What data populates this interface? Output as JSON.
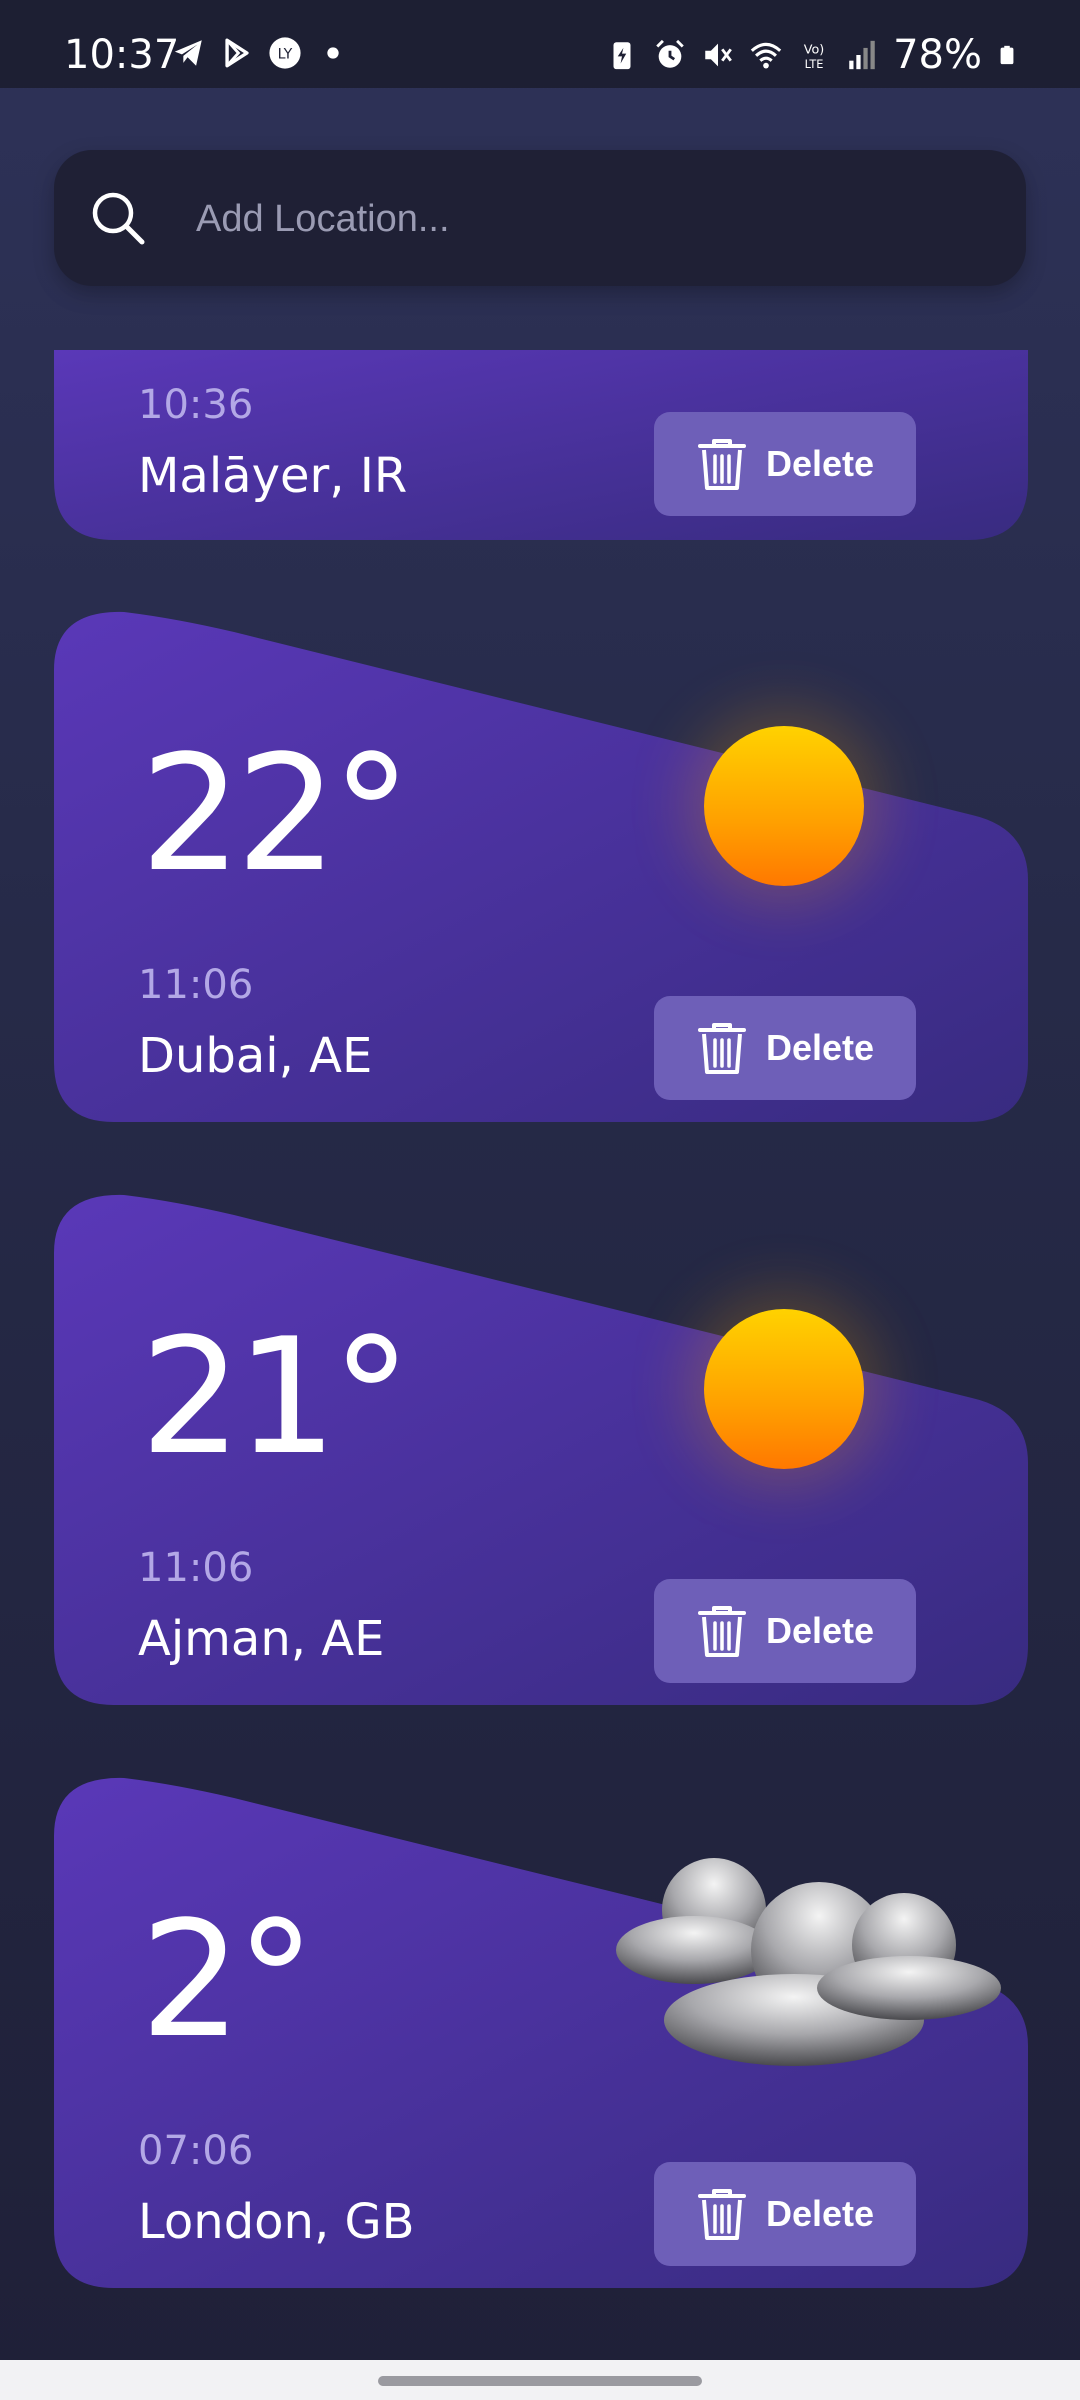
{
  "status_bar": {
    "time": "10:37",
    "battery_percent": "78%",
    "left_icons": [
      "telegram-icon",
      "play-store-icon",
      "ly-app-icon",
      "dot-icon"
    ],
    "right_icons": [
      "battery-saver-icon",
      "alarm-icon",
      "mute-icon",
      "wifi-icon",
      "volte-icon",
      "signal-icon",
      "battery-icon"
    ]
  },
  "search": {
    "placeholder": "Add Location...",
    "value": ""
  },
  "colors": {
    "card_top": "#5637b3",
    "card_bottom": "#3b2d86",
    "delete_button": "#6e5fb8",
    "sun": "#ffc000"
  },
  "cards": [
    {
      "time": "10:36",
      "city": "Malāyer, IR",
      "delete_label": "Delete"
    },
    {
      "temp": "22°",
      "time": "11:06",
      "city": "Dubai, AE",
      "icon": "sun-icon",
      "delete_label": "Delete"
    },
    {
      "temp": "21°",
      "time": "11:06",
      "city": "Ajman, AE",
      "icon": "sun-icon",
      "delete_label": "Delete"
    },
    {
      "temp": "2°",
      "time": "07:06",
      "city": "London, GB",
      "icon": "clouds-icon",
      "delete_label": "Delete"
    }
  ]
}
